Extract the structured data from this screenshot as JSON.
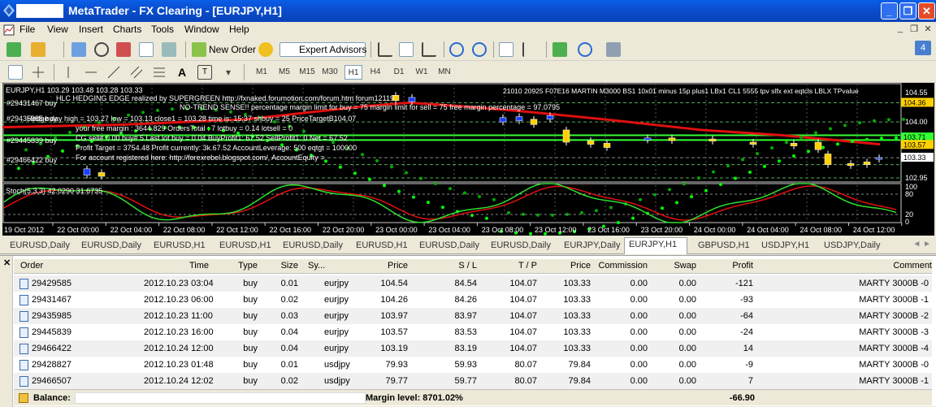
{
  "window": {
    "title": "MetaTrader - FX Clearing - [EURJPY,H1]"
  },
  "menu": [
    "File",
    "View",
    "Insert",
    "Charts",
    "Tools",
    "Window",
    "Help"
  ],
  "toolbar": {
    "new_order": "New Order",
    "expert_advisors": "Expert Advisors"
  },
  "notification_count": "4",
  "timeframes": [
    "M1",
    "M5",
    "M15",
    "M30",
    "H1",
    "H4",
    "D1",
    "W1",
    "MN"
  ],
  "active_timeframe": "H1",
  "chart": {
    "header": "EURJPY,H1  103.29 103.48 103.28 103.33",
    "info_line": "HLC HEDGING EDGE realized by SUPERGREEN http://fxnaked.forumotion.com/forum.htm forum12119",
    "settings_line": "21010 20925 F07E16 MARTIN M3000 BS1 10x01 minus 15p plus1 LBx1 CL1 5555 tpv slfx ext eqtcls LBLX TPvalue",
    "no_trend": "NO-TREND SENSE!! percentage margin limit for buy = 75 margin limit for sell = 75 free margin percentage = 97.0795",
    "day_line": "Hedge day high = 103.27 low = 103.13 close1 = 103.28 time is: 15:37 shbuy = 25 PriceTargetB104.07",
    "margin_line": "your free margin : 3644.829 OrdersTotal : 7 lotbuy = 0.14 lotsell = 0",
    "sell_line": "CG sell# 0 00 buy# 5 Last lot buy = 0.04 BuyProfit1: 67.52 SellProfit1: 0 Net = 67.52",
    "target_line": "Profit Target = 3754.48 Profit currently: 3k.67.52 AccountLeverage: 500 eqtgt = 100000",
    "account_line": "For account registered here: http://forexrebel.blogspot.com/, AccountEquity =",
    "order_labels": [
      "#29431467 buy",
      "#29435985 buy",
      "#29445839 buy",
      "#29466422 buy"
    ],
    "price_labels": [
      "104.55",
      "104.36",
      "104.00",
      "103.71",
      "103.57",
      "103.33",
      "102.95"
    ],
    "stoch_label": "Stoch(5,3,3) 42.0290 31.6735",
    "stoch_levels": [
      "100",
      "80",
      "20",
      "0"
    ],
    "time_labels": [
      "19 Oct 2012",
      "22 Oct 00:00",
      "22 Oct 04:00",
      "22 Oct 08:00",
      "22 Oct 12:00",
      "22 Oct 16:00",
      "22 Oct 20:00",
      "23 Oct 00:00",
      "23 Oct 04:00",
      "23 Oct 08:00",
      "23 Oct 12:00",
      "23 Oct 16:00",
      "23 Oct 20:00",
      "24 Oct 00:00",
      "24 Oct 04:00",
      "24 Oct 08:00",
      "24 Oct 12:00"
    ]
  },
  "chart_tabs": [
    "EURUSD,Daily",
    "EURUSD,Daily",
    "EURUSD,H1",
    "EURUSD,H1",
    "EURUSD,Daily",
    "EURUSD,H1",
    "EURUSD,Daily",
    "EURUSD,Daily",
    "EURJPY,Daily",
    "EURJPY,H1",
    "GBPUSD,H1",
    "USDJPY,H1",
    "USDJPY,Daily"
  ],
  "active_chart_tab": "EURJPY,H1",
  "terminal": {
    "columns": [
      "Order",
      "Time",
      "Type",
      "Size",
      "Sy...",
      "Price",
      "S / L",
      "T / P",
      "Price",
      "Commission",
      "Swap",
      "Profit",
      "Comment"
    ],
    "rows": [
      [
        "29429585",
        "2012.10.23 03:04",
        "buy",
        "0.01",
        "eurjpy",
        "104.54",
        "84.54",
        "104.07",
        "103.33",
        "0.00",
        "0.00",
        "-121",
        "MARTY 3000B -0"
      ],
      [
        "29431467",
        "2012.10.23 06:00",
        "buy",
        "0.02",
        "eurjpy",
        "104.26",
        "84.26",
        "104.07",
        "103.33",
        "0.00",
        "0.00",
        "-93",
        "MARTY 3000B -1"
      ],
      [
        "29435985",
        "2012.10.23 11:00",
        "buy",
        "0.03",
        "eurjpy",
        "103.97",
        "83.97",
        "104.07",
        "103.33",
        "0.00",
        "0.00",
        "-64",
        "MARTY 3000B -2"
      ],
      [
        "29445839",
        "2012.10.23 16:00",
        "buy",
        "0.04",
        "eurjpy",
        "103.57",
        "83.53",
        "104.07",
        "103.33",
        "0.00",
        "0.00",
        "-24",
        "MARTY 3000B -3"
      ],
      [
        "29466422",
        "2012.10.24 12:00",
        "buy",
        "0.04",
        "eurjpy",
        "103.19",
        "83.19",
        "104.07",
        "103.33",
        "0.00",
        "0.00",
        "14",
        "MARTY 3000B -4"
      ],
      [
        "29428827",
        "2012.10.23 01:48",
        "buy",
        "0.01",
        "usdjpy",
        "79.93",
        "59.93",
        "80.07",
        "79.84",
        "0.00",
        "0.00",
        "-9",
        "MARTY 3000B -0"
      ],
      [
        "29466507",
        "2012.10.24 12:02",
        "buy",
        "0.02",
        "usdjpy",
        "79.77",
        "59.77",
        "80.07",
        "79.84",
        "0.00",
        "0.00",
        "7",
        "MARTY 3000B -1"
      ]
    ],
    "balance_label": "Balance:",
    "margin_level": "Margin level: 8701.02%",
    "total_profit": "-66.90"
  }
}
